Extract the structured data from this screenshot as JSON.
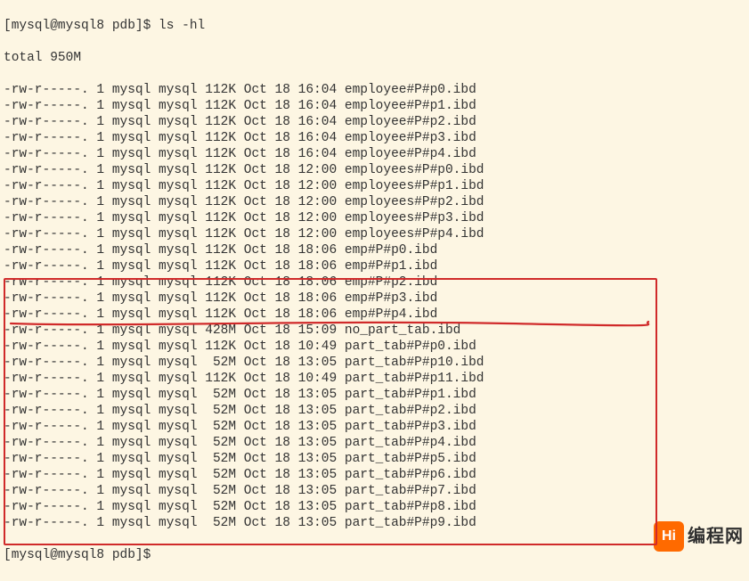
{
  "prompt": "[mysql@mysql8 pdb]$ ",
  "command": "ls -hl",
  "total_line": "total 950M",
  "rows": [
    {
      "perm": "-rw-r-----.",
      "link": "1",
      "owner": "mysql",
      "group": "mysql",
      "size": "112K",
      "month": "Oct",
      "day": "18",
      "time": "16:04",
      "name": "employee#P#p0.ibd"
    },
    {
      "perm": "-rw-r-----.",
      "link": "1",
      "owner": "mysql",
      "group": "mysql",
      "size": "112K",
      "month": "Oct",
      "day": "18",
      "time": "16:04",
      "name": "employee#P#p1.ibd"
    },
    {
      "perm": "-rw-r-----.",
      "link": "1",
      "owner": "mysql",
      "group": "mysql",
      "size": "112K",
      "month": "Oct",
      "day": "18",
      "time": "16:04",
      "name": "employee#P#p2.ibd"
    },
    {
      "perm": "-rw-r-----.",
      "link": "1",
      "owner": "mysql",
      "group": "mysql",
      "size": "112K",
      "month": "Oct",
      "day": "18",
      "time": "16:04",
      "name": "employee#P#p3.ibd"
    },
    {
      "perm": "-rw-r-----.",
      "link": "1",
      "owner": "mysql",
      "group": "mysql",
      "size": "112K",
      "month": "Oct",
      "day": "18",
      "time": "16:04",
      "name": "employee#P#p4.ibd"
    },
    {
      "perm": "-rw-r-----.",
      "link": "1",
      "owner": "mysql",
      "group": "mysql",
      "size": "112K",
      "month": "Oct",
      "day": "18",
      "time": "12:00",
      "name": "employees#P#p0.ibd"
    },
    {
      "perm": "-rw-r-----.",
      "link": "1",
      "owner": "mysql",
      "group": "mysql",
      "size": "112K",
      "month": "Oct",
      "day": "18",
      "time": "12:00",
      "name": "employees#P#p1.ibd"
    },
    {
      "perm": "-rw-r-----.",
      "link": "1",
      "owner": "mysql",
      "group": "mysql",
      "size": "112K",
      "month": "Oct",
      "day": "18",
      "time": "12:00",
      "name": "employees#P#p2.ibd"
    },
    {
      "perm": "-rw-r-----.",
      "link": "1",
      "owner": "mysql",
      "group": "mysql",
      "size": "112K",
      "month": "Oct",
      "day": "18",
      "time": "12:00",
      "name": "employees#P#p3.ibd"
    },
    {
      "perm": "-rw-r-----.",
      "link": "1",
      "owner": "mysql",
      "group": "mysql",
      "size": "112K",
      "month": "Oct",
      "day": "18",
      "time": "12:00",
      "name": "employees#P#p4.ibd"
    },
    {
      "perm": "-rw-r-----.",
      "link": "1",
      "owner": "mysql",
      "group": "mysql",
      "size": "112K",
      "month": "Oct",
      "day": "18",
      "time": "18:06",
      "name": "emp#P#p0.ibd"
    },
    {
      "perm": "-rw-r-----.",
      "link": "1",
      "owner": "mysql",
      "group": "mysql",
      "size": "112K",
      "month": "Oct",
      "day": "18",
      "time": "18:06",
      "name": "emp#P#p1.ibd"
    },
    {
      "perm": "-rw-r-----.",
      "link": "1",
      "owner": "mysql",
      "group": "mysql",
      "size": "112K",
      "month": "Oct",
      "day": "18",
      "time": "18:06",
      "name": "emp#P#p2.ibd"
    },
    {
      "perm": "-rw-r-----.",
      "link": "1",
      "owner": "mysql",
      "group": "mysql",
      "size": "112K",
      "month": "Oct",
      "day": "18",
      "time": "18:06",
      "name": "emp#P#p3.ibd"
    },
    {
      "perm": "-rw-r-----.",
      "link": "1",
      "owner": "mysql",
      "group": "mysql",
      "size": "112K",
      "month": "Oct",
      "day": "18",
      "time": "18:06",
      "name": "emp#P#p4.ibd"
    },
    {
      "perm": "-rw-r-----.",
      "link": "1",
      "owner": "mysql",
      "group": "mysql",
      "size": "428M",
      "month": "Oct",
      "day": "18",
      "time": "15:09",
      "name": "no_part_tab.ibd"
    },
    {
      "perm": "-rw-r-----.",
      "link": "1",
      "owner": "mysql",
      "group": "mysql",
      "size": "112K",
      "month": "Oct",
      "day": "18",
      "time": "10:49",
      "name": "part_tab#P#p0.ibd"
    },
    {
      "perm": "-rw-r-----.",
      "link": "1",
      "owner": "mysql",
      "group": "mysql",
      "size": " 52M",
      "month": "Oct",
      "day": "18",
      "time": "13:05",
      "name": "part_tab#P#p10.ibd"
    },
    {
      "perm": "-rw-r-----.",
      "link": "1",
      "owner": "mysql",
      "group": "mysql",
      "size": "112K",
      "month": "Oct",
      "day": "18",
      "time": "10:49",
      "name": "part_tab#P#p11.ibd"
    },
    {
      "perm": "-rw-r-----.",
      "link": "1",
      "owner": "mysql",
      "group": "mysql",
      "size": " 52M",
      "month": "Oct",
      "day": "18",
      "time": "13:05",
      "name": "part_tab#P#p1.ibd"
    },
    {
      "perm": "-rw-r-----.",
      "link": "1",
      "owner": "mysql",
      "group": "mysql",
      "size": " 52M",
      "month": "Oct",
      "day": "18",
      "time": "13:05",
      "name": "part_tab#P#p2.ibd"
    },
    {
      "perm": "-rw-r-----.",
      "link": "1",
      "owner": "mysql",
      "group": "mysql",
      "size": " 52M",
      "month": "Oct",
      "day": "18",
      "time": "13:05",
      "name": "part_tab#P#p3.ibd"
    },
    {
      "perm": "-rw-r-----.",
      "link": "1",
      "owner": "mysql",
      "group": "mysql",
      "size": " 52M",
      "month": "Oct",
      "day": "18",
      "time": "13:05",
      "name": "part_tab#P#p4.ibd"
    },
    {
      "perm": "-rw-r-----.",
      "link": "1",
      "owner": "mysql",
      "group": "mysql",
      "size": " 52M",
      "month": "Oct",
      "day": "18",
      "time": "13:05",
      "name": "part_tab#P#p5.ibd"
    },
    {
      "perm": "-rw-r-----.",
      "link": "1",
      "owner": "mysql",
      "group": "mysql",
      "size": " 52M",
      "month": "Oct",
      "day": "18",
      "time": "13:05",
      "name": "part_tab#P#p6.ibd"
    },
    {
      "perm": "-rw-r-----.",
      "link": "1",
      "owner": "mysql",
      "group": "mysql",
      "size": " 52M",
      "month": "Oct",
      "day": "18",
      "time": "13:05",
      "name": "part_tab#P#p7.ibd"
    },
    {
      "perm": "-rw-r-----.",
      "link": "1",
      "owner": "mysql",
      "group": "mysql",
      "size": " 52M",
      "month": "Oct",
      "day": "18",
      "time": "13:05",
      "name": "part_tab#P#p8.ibd"
    },
    {
      "perm": "-rw-r-----.",
      "link": "1",
      "owner": "mysql",
      "group": "mysql",
      "size": " 52M",
      "month": "Oct",
      "day": "18",
      "time": "13:05",
      "name": "part_tab#P#p9.ibd"
    }
  ],
  "end_prompt": "[mysql@mysql8 pdb]$ ",
  "logo": {
    "icon": "Hi",
    "text": "编程网"
  }
}
